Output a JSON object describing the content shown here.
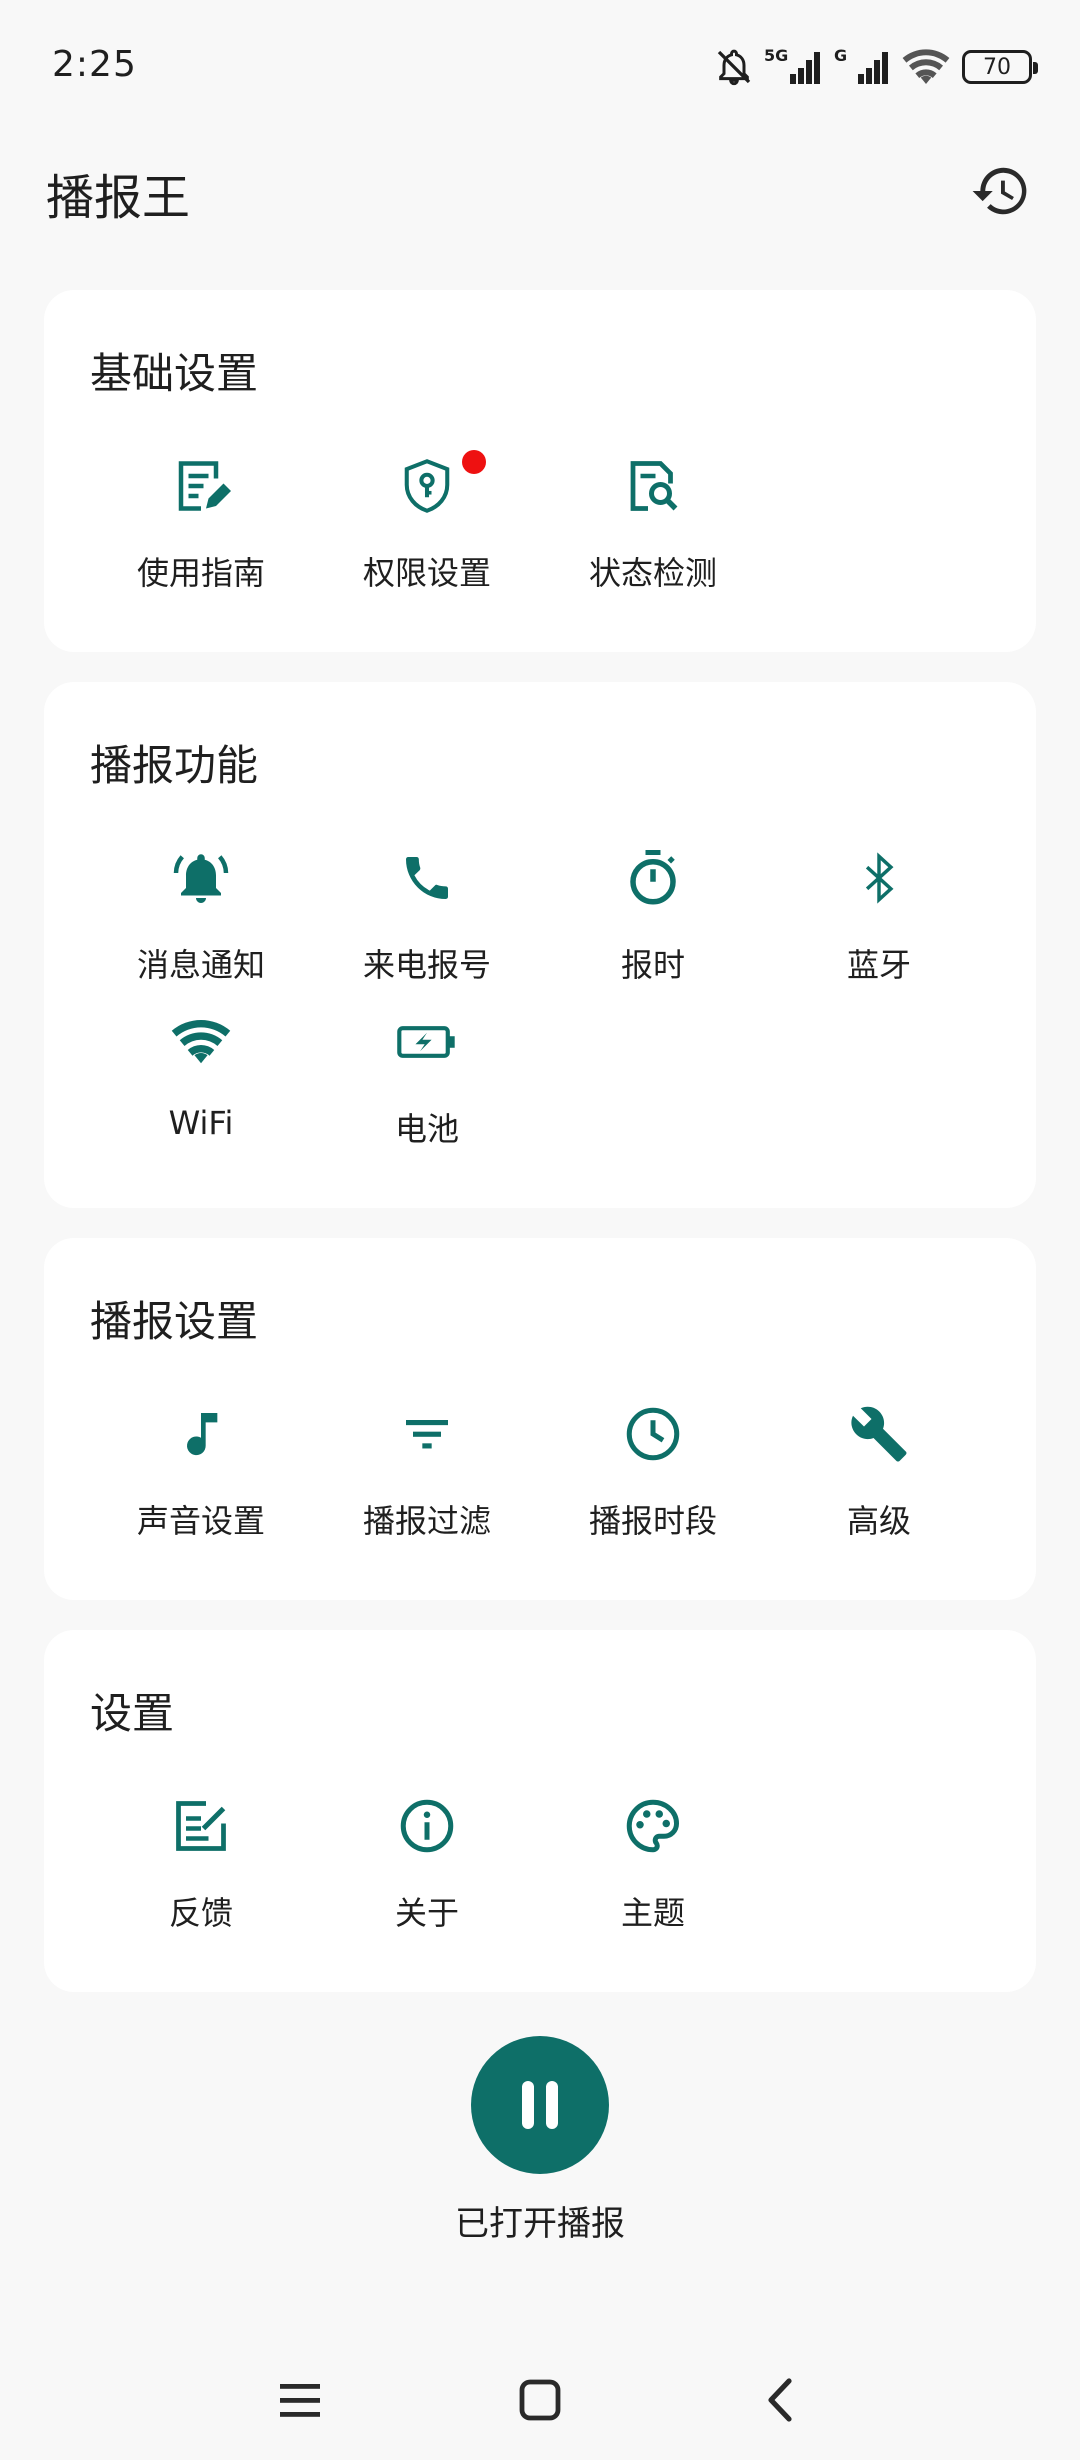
{
  "status": {
    "time": "2:25",
    "network_1": "5G",
    "network_2": "G",
    "battery": "70"
  },
  "header": {
    "title": "播报王",
    "history_icon": "history-icon"
  },
  "colors": {
    "accent": "#0e6f68",
    "badge": "#ee1111",
    "card": "#ffffff",
    "background": "#f8f8f8"
  },
  "sections": [
    {
      "title": "基础设置",
      "items": [
        {
          "label": "使用指南",
          "icon": "guide-icon"
        },
        {
          "label": "权限设置",
          "icon": "shield-key-icon",
          "badge": true
        },
        {
          "label": "状态检测",
          "icon": "document-search-icon"
        }
      ]
    },
    {
      "title": "播报功能",
      "items": [
        {
          "label": "消息通知",
          "icon": "bell-ring-icon"
        },
        {
          "label": "来电报号",
          "icon": "phone-icon"
        },
        {
          "label": "报时",
          "icon": "timer-icon"
        },
        {
          "label": "蓝牙",
          "icon": "bluetooth-icon"
        },
        {
          "label": "WiFi",
          "icon": "wifi-icon"
        },
        {
          "label": "电池",
          "icon": "battery-charging-icon"
        }
      ]
    },
    {
      "title": "播报设置",
      "items": [
        {
          "label": "声音设置",
          "icon": "music-note-icon"
        },
        {
          "label": "播报过滤",
          "icon": "filter-icon"
        },
        {
          "label": "播报时段",
          "icon": "clock-icon"
        },
        {
          "label": "高级",
          "icon": "wrench-icon"
        }
      ]
    },
    {
      "title": "设置",
      "items": [
        {
          "label": "反馈",
          "icon": "edit-note-icon"
        },
        {
          "label": "关于",
          "icon": "info-icon"
        },
        {
          "label": "主题",
          "icon": "palette-icon"
        }
      ]
    }
  ],
  "broadcast": {
    "status_label": "已打开播报",
    "button_icon": "pause-icon"
  },
  "nav": {
    "menu_icon": "menu-icon",
    "home_icon": "home-icon",
    "back_icon": "back-icon"
  }
}
